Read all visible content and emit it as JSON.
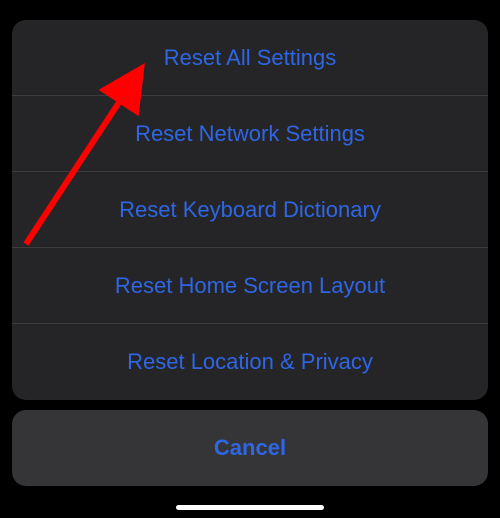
{
  "actionSheet": {
    "options": [
      {
        "label": "Reset All Settings"
      },
      {
        "label": "Reset Network Settings"
      },
      {
        "label": "Reset Keyboard Dictionary"
      },
      {
        "label": "Reset Home Screen Layout"
      },
      {
        "label": "Reset Location & Privacy"
      }
    ],
    "cancel_label": "Cancel"
  }
}
